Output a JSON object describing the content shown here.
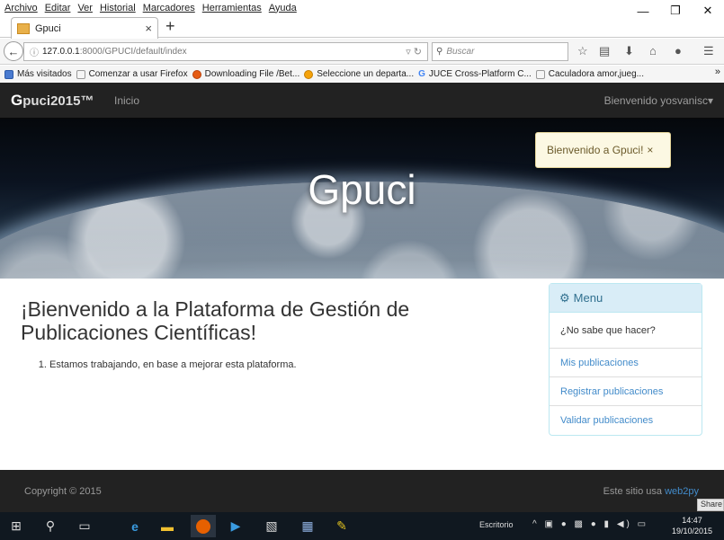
{
  "browser": {
    "menu": [
      "Archivo",
      "Editar",
      "Ver",
      "Historial",
      "Marcadores",
      "Herramientas",
      "Ayuda"
    ],
    "tab_title": "Gpuci",
    "url_host": "127.0.0.1",
    "url_path": ":8000/GPUCI/default/index",
    "search_placeholder": "Buscar",
    "bookmarks": [
      "Más visitados",
      "Comenzar a usar Firefox",
      "Downloading File /Bet...",
      "Seleccione un departa...",
      "JUCE Cross-Platform C...",
      "Caculadora amor,jueg..."
    ]
  },
  "site": {
    "brand": "Gpuci2015™",
    "brand_first": "G",
    "brand_rest": "puci2015™",
    "nav_link": "Inicio",
    "welcome_user": "Bienvenido yosvanisc▾",
    "hero_title": "Gpuci",
    "flash": "Bienvenido a Gpuci!",
    "flash_close": "×"
  },
  "main": {
    "heading": "¡Bienvenido a la Plataforma de Gestión de Publicaciones Científicas!",
    "list": [
      "Estamos trabajando, en base a mejorar esta plataforma."
    ]
  },
  "sidemenu": {
    "title": "Menu",
    "items": [
      "¿No sabe que hacer?",
      "Mis publicaciones",
      "Registrar publicaciones",
      "Validar publicaciones"
    ]
  },
  "footer": {
    "copyright": "Copyright © 2015",
    "powered_prefix": "Este sitio usa",
    "powered_link": "web2py",
    "share": "Share"
  },
  "taskbar": {
    "desktop_label": "Escritorio",
    "time": "14:47",
    "date": "19/10/2015"
  }
}
